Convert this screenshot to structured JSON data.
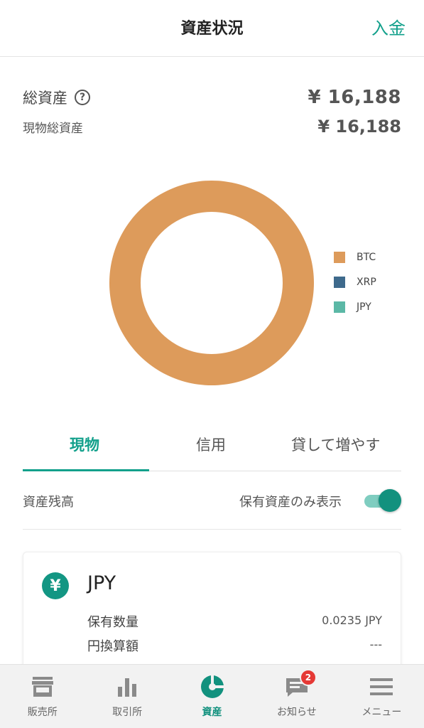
{
  "header": {
    "title": "資産状況",
    "deposit_label": "入金"
  },
  "summary": {
    "total_label": "総資産",
    "total_value": "¥ 16,188",
    "spot_label": "現物総資産",
    "spot_value": "¥ 16,188"
  },
  "chart_data": {
    "type": "pie",
    "style": "donut",
    "categories": [
      "BTC",
      "XRP",
      "JPY"
    ],
    "values": [
      100,
      0,
      0
    ],
    "colors": [
      "#dd9b5b",
      "#3e6a8c",
      "#5bb8a6"
    ],
    "legend": "right"
  },
  "tabs": [
    {
      "label": "現物",
      "active": true
    },
    {
      "label": "信用",
      "active": false
    },
    {
      "label": "貸して増やす",
      "active": false
    }
  ],
  "balance": {
    "label": "資産残高",
    "toggle_label": "保有資産のみ表示",
    "toggle_on": true
  },
  "asset_card": {
    "icon_symbol": "¥",
    "name": "JPY",
    "rows": [
      {
        "label": "保有数量",
        "value": "0.0235 JPY"
      },
      {
        "label": "円換算額",
        "value": "---"
      }
    ]
  },
  "bottom_nav": [
    {
      "label": "販売所",
      "icon": "store-icon"
    },
    {
      "label": "取引所",
      "icon": "bar-chart-icon"
    },
    {
      "label": "資産",
      "icon": "pie-chart-icon",
      "active": true
    },
    {
      "label": "お知らせ",
      "icon": "message-icon",
      "badge": "2"
    },
    {
      "label": "メニュー",
      "icon": "menu-icon"
    }
  ],
  "colors": {
    "accent": "#12a08b",
    "badge": "#e53935"
  }
}
